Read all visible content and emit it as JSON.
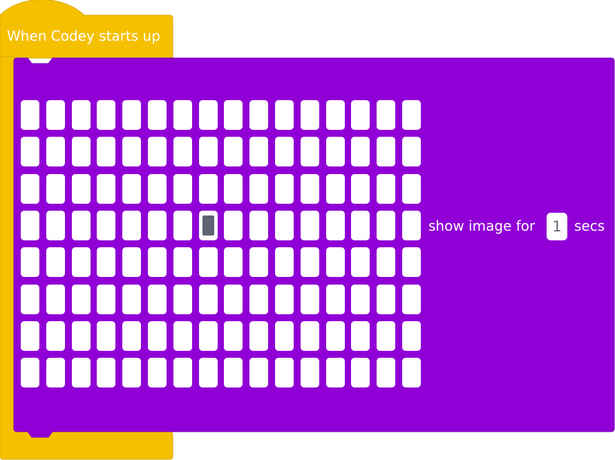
{
  "hat_block": {
    "label": "When Codey starts up",
    "color": "#f5c000"
  },
  "show_block": {
    "color": "#9000d6",
    "text_before": "show image for",
    "seconds_value": "1",
    "text_after": "secs",
    "led_matrix": {
      "rows": 8,
      "columns": 16,
      "lit_cells": [
        {
          "row": 3,
          "column": 7
        }
      ],
      "cell_color": "#ffffff",
      "lit_color": "#5e6473"
    }
  }
}
